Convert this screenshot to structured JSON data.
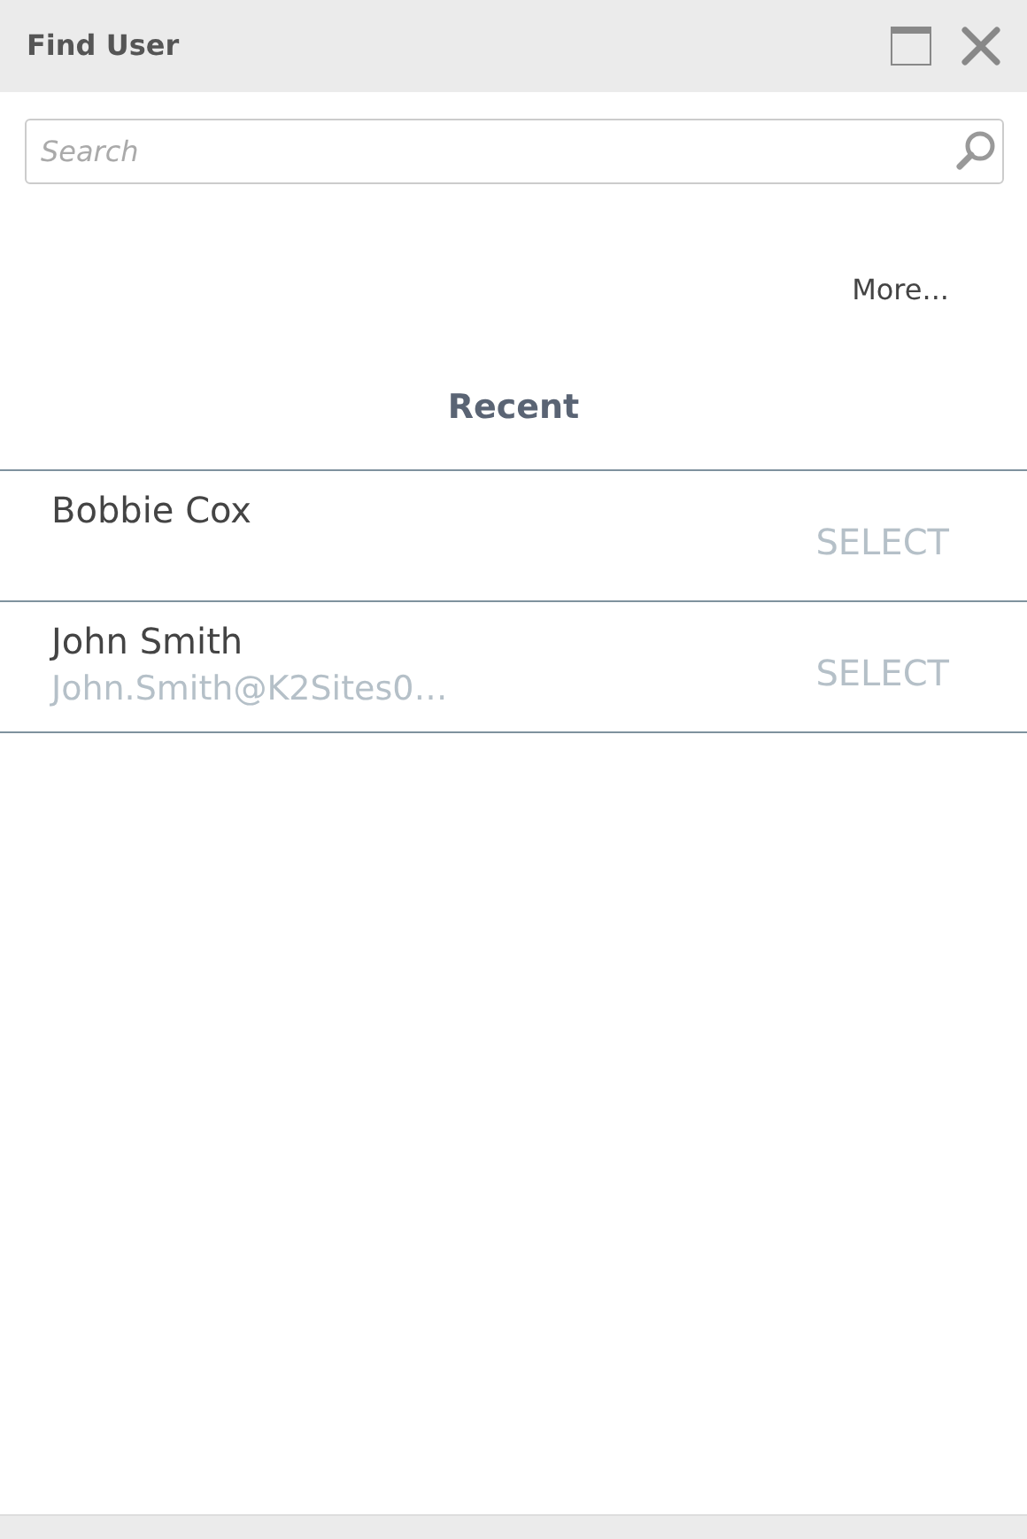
{
  "window": {
    "title": "Find User"
  },
  "search": {
    "placeholder": "Search"
  },
  "more_link": "More...",
  "section_title": "Recent",
  "users": [
    {
      "name": "Bobbie Cox",
      "action": "SELECT"
    },
    {
      "name": "John Smith",
      "email": "John.Smith@K2Sites0…",
      "action": "SELECT"
    }
  ]
}
